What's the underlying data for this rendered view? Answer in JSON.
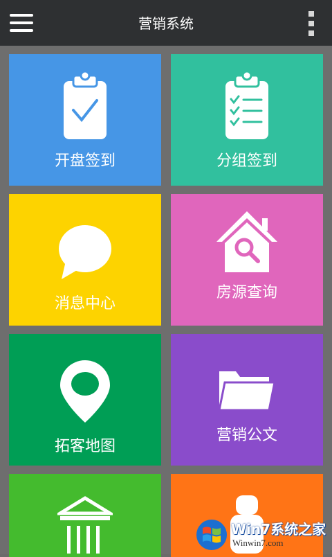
{
  "header": {
    "title": "营销系统",
    "menu_icon": "hamburger-menu-icon",
    "more_icon": "more-vertical-icon"
  },
  "tiles": [
    {
      "label": "开盘签到",
      "icon": "clipboard-check-icon",
      "color": "#4696e6"
    },
    {
      "label": "分组签到",
      "icon": "clipboard-list-icon",
      "color": "#31c09e"
    },
    {
      "label": "消息中心",
      "icon": "speech-bubble-icon",
      "color": "#fdd300"
    },
    {
      "label": "房源查询",
      "icon": "house-search-icon",
      "color": "#e066bc"
    },
    {
      "label": "拓客地图",
      "icon": "map-pin-icon",
      "color": "#009e55"
    },
    {
      "label": "营销公文",
      "icon": "folder-icon",
      "color": "#8a4ccb"
    },
    {
      "label": "",
      "icon": "building-icon",
      "color": "#44bb2e"
    },
    {
      "label": "",
      "icon": "person-icon",
      "color": "#ff7416"
    }
  ],
  "watermark": {
    "name": "Win7系统之家",
    "url": "Winwin7.com"
  }
}
